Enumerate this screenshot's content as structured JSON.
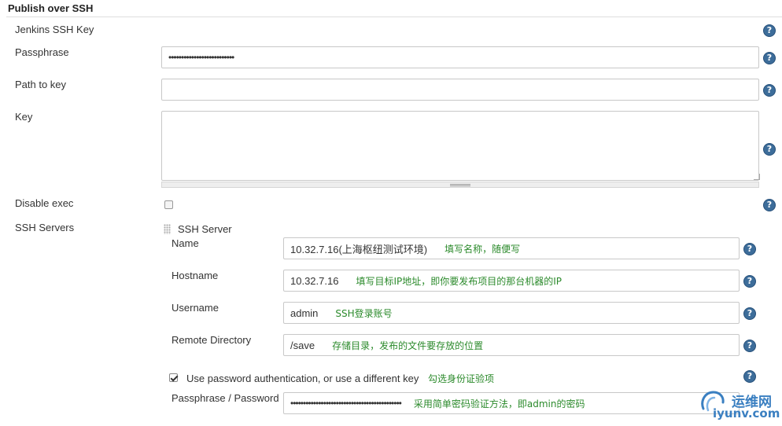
{
  "section": {
    "title": "Publish over SSH"
  },
  "key_section": {
    "jenkins_ssh_key_label": "Jenkins SSH Key",
    "passphrase_label": "Passphrase",
    "passphrase_value": "••••••••••••••••••••••••••",
    "path_to_key_label": "Path to key",
    "path_to_key_value": "",
    "key_label": "Key",
    "key_value": "",
    "disable_exec_label": "Disable exec",
    "disable_exec_checked": false
  },
  "ssh_servers": {
    "label": "SSH Servers",
    "server_header": "SSH Server",
    "name_label": "Name",
    "name_value": "10.32.7.16(上海枢纽测试环境)",
    "name_note": "填写名称，随便写",
    "hostname_label": "Hostname",
    "hostname_value": "10.32.7.16",
    "hostname_note": "填写目标IP地址，即你要发布项目的那台机器的IP",
    "username_label": "Username",
    "username_value": "admin",
    "username_note": "SSH登录账号",
    "remote_dir_label": "Remote Directory",
    "remote_dir_value": "/save",
    "remote_dir_note": "存储目录，发布的文件要存放的位置",
    "use_password_label": "Use password authentication, or use a different key",
    "use_password_checked": true,
    "use_password_note": "勾选身份证验项",
    "password_label": "Passphrase / Password",
    "password_value": "••••••••••••••••••••••••••••••••••••••••••••",
    "password_note": "采用简单密码验证方法，即admin的密码"
  },
  "help_icon_glyph": "?",
  "watermark": {
    "cn": "运维网",
    "en": "iyunv.com"
  },
  "colors": {
    "help": "#3d6d9a",
    "note": "#2b8a2b",
    "watermark": "#3a7fc1"
  }
}
